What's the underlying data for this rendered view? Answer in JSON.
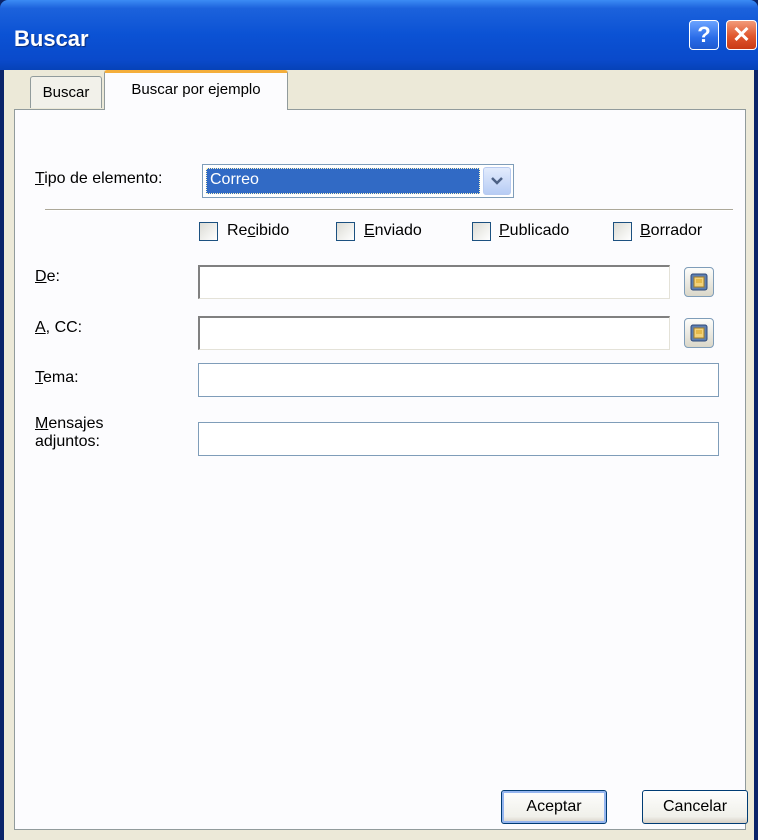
{
  "window": {
    "title": "Buscar",
    "help_glyph": "?",
    "close_glyph": "✕"
  },
  "tabs": [
    {
      "label": "Buscar"
    },
    {
      "label": "Buscar por ejemplo"
    }
  ],
  "item_type": {
    "label_mnemonic": "T",
    "label_rest": "ipo de elemento:",
    "value": "Correo"
  },
  "checkboxes": [
    {
      "pre": "Re",
      "mnemonic": "c",
      "post": "ibido",
      "checked": false
    },
    {
      "pre": "",
      "mnemonic": "E",
      "post": "nviado",
      "checked": false
    },
    {
      "pre": "",
      "mnemonic": "P",
      "post": "ublicado",
      "checked": false
    },
    {
      "pre": "",
      "mnemonic": "B",
      "post": "orrador",
      "checked": false
    }
  ],
  "fields": {
    "from": {
      "mnemonic": "D",
      "rest": "e:",
      "value": ""
    },
    "to_cc": {
      "mnemonic": "A",
      "rest": ", CC:",
      "value": ""
    },
    "subject": {
      "mnemonic": "T",
      "rest": "ema:",
      "value": ""
    },
    "attachments": {
      "mnemonic": "M",
      "line1_rest": "ensajes",
      "line2": "adjuntos:",
      "value": ""
    }
  },
  "buttons": {
    "ok": "Aceptar",
    "cancel": "Cancelar"
  },
  "colors": {
    "titlebar": "#0B52D4",
    "tab_accent": "#F4AE3B",
    "selection": "#316AC5",
    "dialog_bg": "#ECE9D8"
  }
}
